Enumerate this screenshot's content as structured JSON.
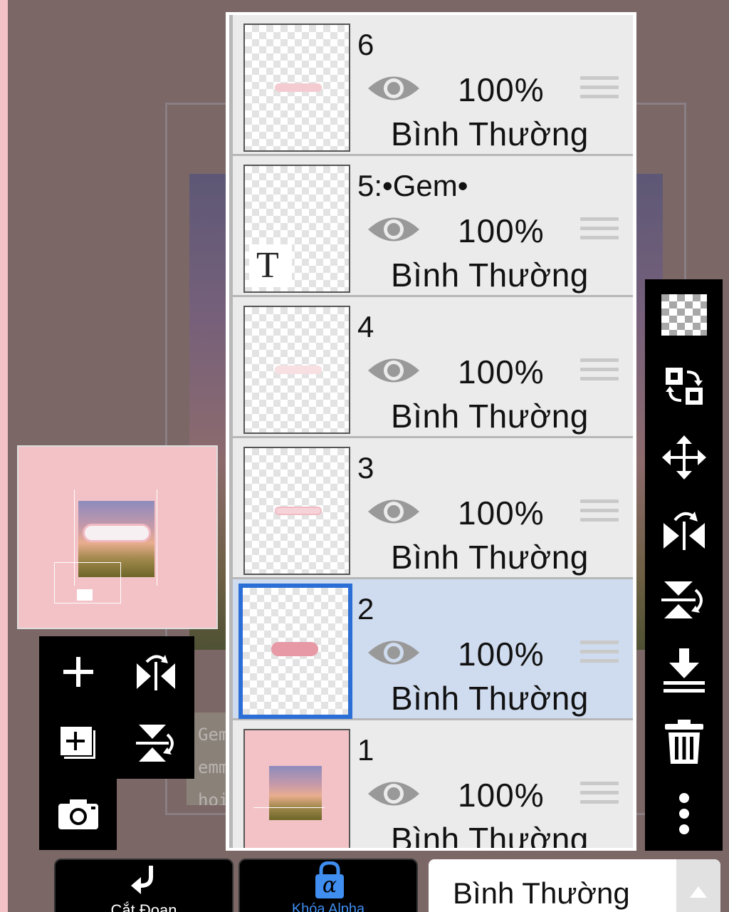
{
  "background_text": [
    "Gem",
    "emm",
    "hoic"
  ],
  "layers": [
    {
      "name": "6",
      "visibility_icon": "eye-icon",
      "opacity": "100%",
      "blend": "Bình Thường",
      "selected": false
    },
    {
      "name": "5:•Gem•",
      "visibility_icon": "eye-icon",
      "opacity": "100%",
      "blend": "Bình Thường",
      "selected": false,
      "type_badge": "T"
    },
    {
      "name": "4",
      "visibility_icon": "eye-icon",
      "opacity": "100%",
      "blend": "Bình Thường",
      "selected": false
    },
    {
      "name": "3",
      "visibility_icon": "eye-icon",
      "opacity": "100%",
      "blend": "Bình Thường",
      "selected": false
    },
    {
      "name": "2",
      "visibility_icon": "eye-icon",
      "opacity": "100%",
      "blend": "Bình Thường",
      "selected": true
    },
    {
      "name": "1",
      "visibility_icon": "eye-icon",
      "opacity": "100%",
      "blend": "Bình Thường",
      "selected": false
    }
  ],
  "left_tools": [
    "add-layer-icon",
    "flip-horizontal-icon",
    "duplicate-layer-icon",
    "flip-vertical-icon",
    "camera-icon"
  ],
  "right_tools": [
    "transparency-icon",
    "swap-layer-icon",
    "move-icon",
    "flip-horizontal-icon",
    "flip-vertical-icon",
    "merge-down-icon",
    "trash-icon",
    "more-icon"
  ],
  "bottom_bar": {
    "clip_label": "Cắt Đoạn",
    "alpha_lock_label": "Khóa Alpha",
    "alpha_symbol": "α",
    "blend_mode": "Bình Thường"
  },
  "colors": {
    "background": "#7b6766",
    "panel_row": "#ebebeb",
    "selected_row": "#cfdbee",
    "selected_border": "#2b6fd6",
    "accent_blue": "#3f8ef0",
    "pink": "#f2c2c6"
  }
}
